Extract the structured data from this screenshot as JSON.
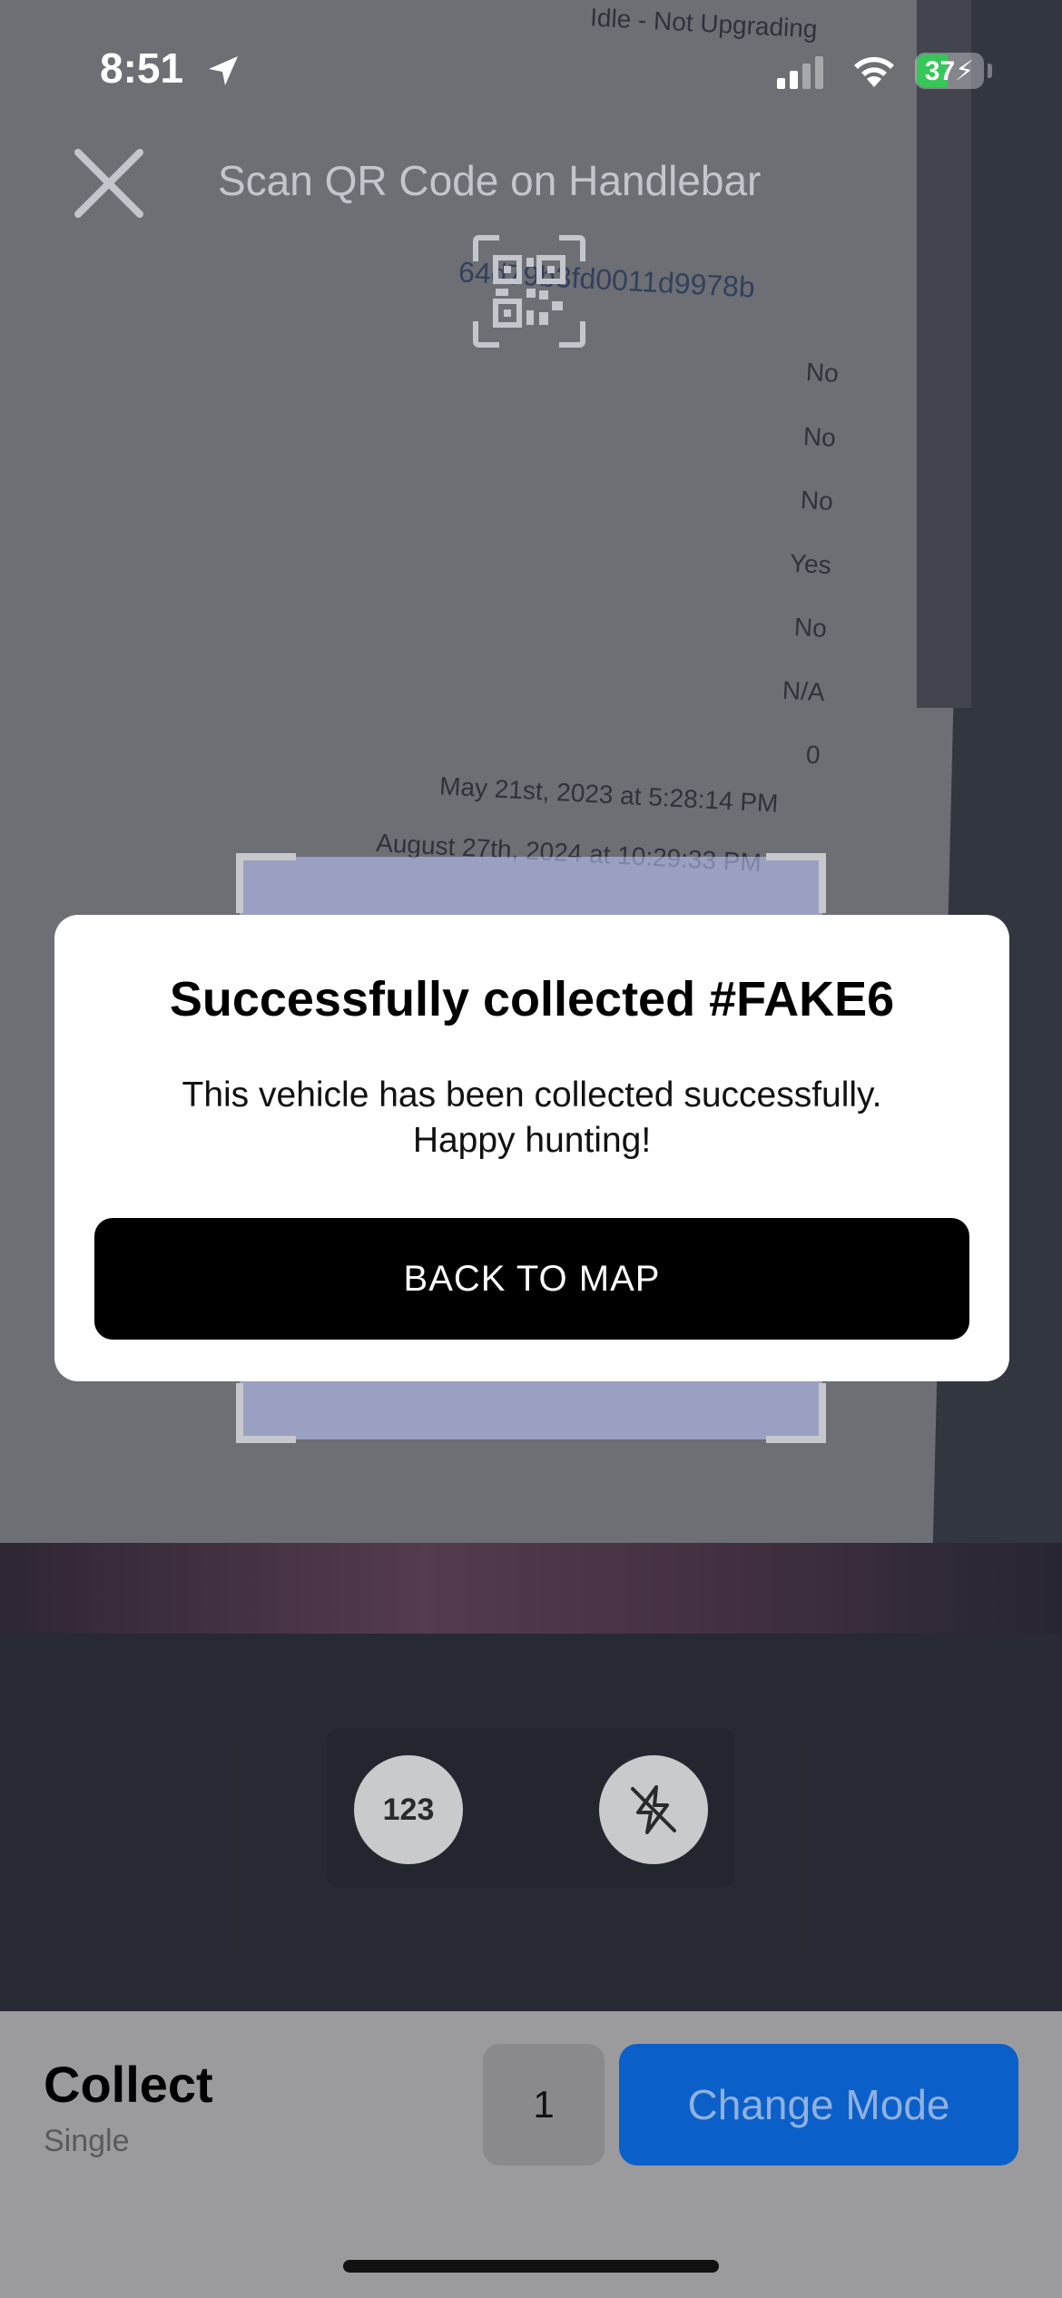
{
  "status_bar": {
    "time": "8:51",
    "battery": "37",
    "icons": [
      "location-arrow-icon",
      "cellular-signal-icon",
      "wifi-icon",
      "battery-charging-icon"
    ]
  },
  "header": {
    "title": "Scan QR Code on Handlebar",
    "close_icon": "close-icon",
    "qr_icon": "qr-code-icon"
  },
  "background_document": {
    "top_text": "Idle - Not Upgrading",
    "hash": "64d79b3fd0011d9978b",
    "values": [
      "No",
      "No",
      "No",
      "Yes",
      "No",
      "N/A",
      "0"
    ],
    "date1": "May 21st, 2023 at 5:28:14 PM",
    "date2": "August 27th, 2024 at 10:29:33 PM"
  },
  "modal": {
    "title": "Successfully collected #FAKE6",
    "body_line1": "This vehicle has been collected successfully.",
    "body_line2": "Happy hunting!",
    "button_label": "BACK TO MAP"
  },
  "camera_controls": {
    "keypad_label": "123",
    "flash_icon": "flash-off-icon"
  },
  "bottom_panel": {
    "mode_title": "Collect",
    "mode_subtitle": "Single",
    "count": "1",
    "change_mode_label": "Change Mode",
    "accent_color": "#0b5fc9"
  }
}
